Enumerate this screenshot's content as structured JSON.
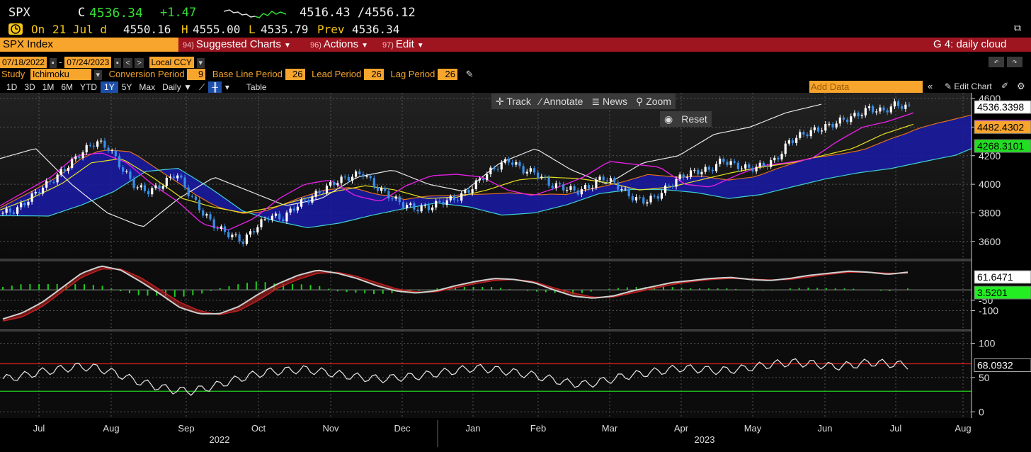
{
  "header": {
    "ticker": "SPX",
    "last_prefix": "C",
    "last": "4536.34",
    "change": "+1.47",
    "range": "4516.43 /4556.12",
    "on_label": "On",
    "date": "21 Jul d",
    "open": "4550.16",
    "high_label": "H",
    "high": "4555.00",
    "low_label": "L",
    "low": "4535.79",
    "prev_label": "Prev",
    "prev": "4536.34"
  },
  "menubar": {
    "security": "SPX Index",
    "items": [
      {
        "num": "94)",
        "label": "Suggested Charts"
      },
      {
        "num": "96)",
        "label": "Actions"
      },
      {
        "num": "97)",
        "label": "Edit"
      }
    ],
    "chart_name": "G 4: daily cloud"
  },
  "range_row": {
    "start": "07/18/2022",
    "end": "07/24/2023",
    "currency": "Local CCY"
  },
  "study_row": {
    "study_label": "Study",
    "study": "Ichimoku",
    "conversion_label": "Conversion Period",
    "conversion": "9",
    "base_label": "Base Line Period",
    "base": "26",
    "lead_label": "Lead Period",
    "lead": "26",
    "lag_label": "Lag Period",
    "lag": "26"
  },
  "toolbar": {
    "periods": [
      "1D",
      "3D",
      "1M",
      "6M",
      "YTD",
      "1Y",
      "5Y",
      "Max"
    ],
    "selected": "1Y",
    "frequency": "Daily",
    "table": "Table",
    "add_data_placeholder": "Add Data",
    "edit_chart": "Edit Chart"
  },
  "hover_menu": {
    "track": "Track",
    "annotate": "Annotate",
    "news": "News",
    "zoom": "Zoom",
    "reset": "Reset"
  },
  "colors": {
    "cloud_fill": "#1a1aa8",
    "price_up": "#ffffff",
    "price_down": "#3a8ee6",
    "conversion_line": "#e020e0",
    "base_line": "#e8e020",
    "lead_line": "#e07020",
    "lead_b_line": "#40d0d0",
    "lag_line": "#e8e8e8",
    "macd_line": "#d0d0d0",
    "signal_line": "#c02020",
    "histogram": "#22cc22",
    "rsi_line": "#e8e8e8",
    "rsi_overbought": "#dd2020",
    "rsi_oversold": "#22cc22"
  },
  "chart_data": [
    {
      "type": "candlestick",
      "title": "",
      "study": "Ichimoku",
      "x_months": [
        "Jul",
        "Aug",
        "Sep",
        "Oct",
        "Nov",
        "Dec",
        "Jan",
        "Feb",
        "Mar",
        "Apr",
        "May",
        "Jun",
        "Jul",
        "Aug"
      ],
      "x_years": [
        "2022",
        "2023"
      ],
      "y_ticks": [
        3600,
        3800,
        4000,
        4200,
        4400,
        4600
      ],
      "ylim": [
        3480,
        4640
      ],
      "price_path": [
        3800,
        3820,
        3900,
        3980,
        4050,
        4140,
        4230,
        4300,
        4250,
        4100,
        3980,
        3950,
        4000,
        4080,
        3930,
        3800,
        3700,
        3650,
        3600,
        3700,
        3780,
        3760,
        3850,
        3900,
        3960,
        4020,
        4050,
        4080,
        3980,
        3920,
        3860,
        3830,
        3840,
        3880,
        3900,
        3960,
        4050,
        4120,
        4170,
        4100,
        4080,
        4000,
        3980,
        3950,
        3980,
        4050,
        4000,
        3920,
        3880,
        3910,
        3990,
        4060,
        4090,
        4100,
        4170,
        4130,
        4110,
        4130,
        4170,
        4300,
        4350,
        4380,
        4410,
        4450,
        4480,
        4530,
        4510,
        4560,
        4536
      ],
      "conversion_line": [
        3850,
        3950,
        4050,
        4200,
        4220,
        4150,
        4000,
        3880,
        3720,
        3680,
        3760,
        3900,
        4000,
        4030,
        3920,
        3880,
        3990,
        4060,
        4070,
        4050,
        3960,
        3920,
        3980,
        4050,
        4160,
        4140,
        4120,
        4000,
        3980,
        4060,
        4130,
        4150,
        4180,
        4300,
        4400,
        4440,
        4500
      ],
      "base_line": [
        3820,
        3900,
        4000,
        4150,
        4180,
        4050,
        3900,
        3840,
        3800,
        3840,
        3900,
        3950,
        3990,
        3960,
        3900,
        3910,
        3960,
        4030,
        4050,
        4040,
        4010,
        3960,
        3980,
        4030,
        4080,
        4120,
        4150,
        4200,
        4250,
        4350,
        4420
      ],
      "lag_line": [
        4180,
        4250,
        4000,
        3800,
        3700,
        3900,
        4050,
        3950,
        3850,
        3900,
        4050,
        4100,
        4000,
        3950,
        4150,
        4250,
        4100,
        4000,
        4150,
        4200,
        4350,
        4400,
        4500,
        4560
      ],
      "last_price_label": "4536.3398",
      "cloud_top_label": "4482.4302",
      "cloud_bottom_label": "4268.3101"
    },
    {
      "type": "line",
      "title": "",
      "series": [
        {
          "name": "",
          "values": [
            -140,
            -110,
            -60,
            10,
            80,
            115,
            95,
            40,
            -20,
            -85,
            -115,
            -115,
            -80,
            -20,
            30,
            70,
            95,
            80,
            55,
            20,
            -5,
            -15,
            -5,
            20,
            40,
            55,
            50,
            35,
            0,
            -30,
            -40,
            -30,
            -5,
            15,
            35,
            45,
            55,
            60,
            50,
            45,
            55,
            70,
            80,
            90,
            85,
            75,
            85
          ]
        },
        {
          "name": "",
          "values": [
            -150,
            -130,
            -80,
            -10,
            60,
            100,
            100,
            60,
            0,
            -60,
            -100,
            -120,
            -100,
            -50,
            10,
            50,
            80,
            85,
            65,
            35,
            5,
            -10,
            -10,
            10,
            30,
            45,
            50,
            40,
            10,
            -15,
            -35,
            -35,
            -15,
            5,
            25,
            40,
            50,
            55,
            52,
            48,
            50,
            62,
            75,
            85,
            85,
            80,
            80
          ]
        }
      ],
      "y_ticks": [
        -100,
        -50
      ],
      "ylim": [
        -180,
        130
      ],
      "last_labels": [
        "61.6471",
        "3.5201"
      ]
    },
    {
      "type": "line",
      "title": "",
      "series": [
        {
          "name": "",
          "values": [
            48,
            52,
            58,
            62,
            66,
            64,
            56,
            46,
            38,
            32,
            30,
            36,
            44,
            52,
            58,
            60,
            62,
            58,
            54,
            50,
            48,
            50,
            52,
            56,
            60,
            64,
            62,
            58,
            54,
            48,
            42,
            40,
            46,
            52,
            56,
            60,
            64,
            62,
            60,
            62,
            66,
            70,
            72,
            70,
            66,
            68,
            72,
            70,
            68
          ]
        }
      ],
      "y_ticks": [
        0,
        50,
        100
      ],
      "ylim": [
        -8,
        115
      ],
      "overbought": 70,
      "oversold": 30,
      "last_label": "68.0932"
    }
  ]
}
